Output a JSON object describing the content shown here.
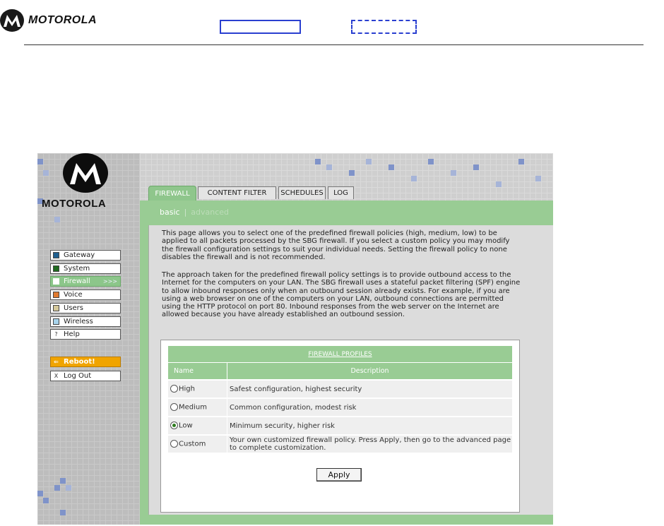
{
  "doc_header": {
    "brand": "MOTOROLA"
  },
  "app": {
    "brand": "MOTOROLA",
    "nav": [
      {
        "label": "Gateway",
        "color": "#1f5f8f"
      },
      {
        "label": "System",
        "color": "#1f6a1f"
      },
      {
        "label": "Firewall",
        "arrow": ">>>",
        "color": "#ffffff"
      },
      {
        "label": "Voice",
        "color": "#e07a30"
      },
      {
        "label": "Users",
        "color": "#d4c89a"
      },
      {
        "label": "Wireless",
        "color": "#a8d4ec"
      },
      {
        "label": "Help",
        "icon": "?"
      }
    ],
    "reboot": {
      "label": "Reboot!",
      "icon": "⇐"
    },
    "logout": {
      "label": "Log Out",
      "icon": "X"
    },
    "tabs": [
      "FIREWALL",
      "CONTENT FILTER",
      "SCHEDULES",
      "LOG"
    ],
    "subtabs": {
      "basic": "basic",
      "separator": "|",
      "advanced": "advanced"
    },
    "intro_1": "This page allows you to select one of the predefined firewall policies (high, medium, low) to be applied to all packets processed by the SBG firewall. If you select a custom policy you may modify the firewall configuration settings to suit your individual needs. Setting the firewall policy to none disables the firewall and is not recommended.",
    "intro_2": "The approach taken for the predefined firewall policy settings is to provide outbound access to the Internet for the computers on your LAN. The SBG firewall uses a stateful packet filtering (SPF) engine to allow inbound responses only when an outbound session already exists. For example, if you are using a web browser on one of the computers on your LAN, outbound connections are permitted using the HTTP protocol on port 80. Inbound responses from the web server on the Internet are allowed because you have already established an outbound session.",
    "profiles": {
      "title": "FIREWALL PROFILES",
      "col_name": "Name",
      "col_desc": "Description",
      "rows": [
        {
          "name": "High",
          "desc": "Safest configuration, highest security",
          "selected": false
        },
        {
          "name": "Medium",
          "desc": "Common configuration, modest risk",
          "selected": false
        },
        {
          "name": "Low",
          "desc": "Minimum security, higher risk",
          "selected": true
        },
        {
          "name": "Custom",
          "desc": "Your own customized firewall policy. Press Apply, then go to the advanced page to complete customization.",
          "selected": false
        }
      ]
    },
    "apply_label": "Apply"
  }
}
